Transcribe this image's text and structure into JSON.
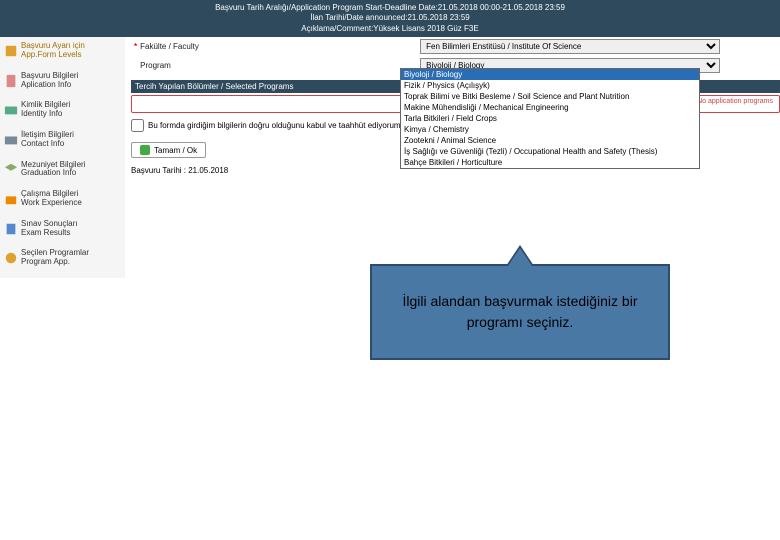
{
  "header": {
    "line1": "Başvuru Tarih Aralığı/Application Program Start-Deadline Date:21.05.2018 00:00-21.05.2018 23:59",
    "line2": "İlan Tarihi/Date announced:21.05.2018 23:59",
    "line3": "Açıklama/Comment:Yüksek Lisans 2018 Güz F3E"
  },
  "sidebar": {
    "items": [
      {
        "label": "Başvuru Ayarı için\nApp.Form Levels"
      },
      {
        "label": "Başvuru Bilgileri\nAplication Info"
      },
      {
        "label": "Kimlik Bilgileri\nIdentity Info"
      },
      {
        "label": "İletişim Bilgileri\nContact Info"
      },
      {
        "label": "Mezuniyet Bilgileri\nGraduation Info"
      },
      {
        "label": "Çalışma Bilgileri\nWork Experience"
      },
      {
        "label": "Sınav Sonuçları\nExam Results"
      },
      {
        "label": "Seçilen Programlar\nProgram App."
      }
    ]
  },
  "form": {
    "faculty_label": "Fakülte / Faculty",
    "program_label": "Program",
    "faculty_selected": "Fen Bilimleri Enstitüsü / Institute Of Science",
    "program_selected": "Biyoloji / Biology"
  },
  "section_bar": "Tercih Yapılan Bölümler / Selected Programs",
  "group_note": "Başvuru yapılan program yok / No application programs",
  "declaration": "Bu formda girdiğim bilgilerin doğru olduğunu kabul ve taahhüt ediyorum. / I declare that the information I have ",
  "ok_button": "Tamam / Ok",
  "date_line": "Başvuru Tarihi : 21.05.2018",
  "dropdown": {
    "options": [
      "Biyoloji / Biology",
      "Fizik / Physics (Açılışyk)",
      "Toprak Bilimi ve Bitki Besleme / Soil Science and Plant Nutrition",
      "Makine Mühendisliği / Mechanical Engineering",
      "Tarla Bitkileri / Field Crops",
      "Kimya / Chemistry",
      "Zootekni / Animal Science",
      "İş Sağlığı ve Güvenliği (Tezli) / Occupational Health and Safety (Thesis)",
      "Bahçe Bitkileri / Horticulture"
    ],
    "selected_index": 0
  },
  "callout": "İlgili alandan başvurmak istediğiniz bir programı seçiniz."
}
